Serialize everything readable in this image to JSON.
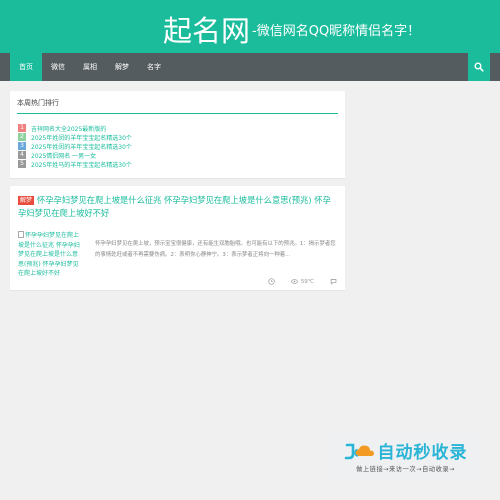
{
  "header": {
    "site_name": "起名网",
    "slogan": "-微信网名QQ昵称情侣名字！"
  },
  "nav": {
    "items": [
      {
        "label": "首页",
        "active": true
      },
      {
        "label": "微信",
        "active": false
      },
      {
        "label": "属相",
        "active": false
      },
      {
        "label": "解梦",
        "active": false
      },
      {
        "label": "名字",
        "active": false
      }
    ],
    "search_icon": "search-icon"
  },
  "ranking": {
    "title": "本周热门排行",
    "items": [
      {
        "num": "1",
        "text": "吉祥网名大全2025最新版的",
        "color": "#f08080"
      },
      {
        "num": "2",
        "text": "2025年姓闵的羊年宝宝起名精选30个",
        "color": "#8fd19e"
      },
      {
        "num": "3",
        "text": "2025年姓闵的羊年宝宝起名精选30个",
        "color": "#6aa8dc"
      },
      {
        "num": "4",
        "text": "2025情侣网名 一男一女",
        "color": "#999999"
      },
      {
        "num": "5",
        "text": "2025年姓马的羊年宝宝起名精选30个",
        "color": "#999999"
      }
    ]
  },
  "article": {
    "badge": "解梦",
    "title": "怀孕孕妇梦见在爬上坡是什么征兆 怀孕孕妇梦见在爬上坡是什么意思(预兆) 怀孕孕妇梦见在爬上坡好不好",
    "thumb_alt": "怀孕孕妇梦见在爬上坡是什么征兆 怀孕孕妇梦见在爬上坡是什么意思(预兆) 怀孕孕妇梦见在爬上坡好不好",
    "excerpt": "怀孕孕妇梦见在爬上坡，预示宝宝很健康，还有能生双胞胎哦。也可能有以下的预兆。1：揭示梦者您的事情乾旺或者不再需要伤病。2：表明你心静神宁。3：表示梦者正将向一种着...",
    "views": "59℃"
  },
  "watermark": {
    "text": "自动秒收录",
    "tagline": "做上链接→来访一次→自动收录→"
  },
  "colors": {
    "brand": "#1abc9c",
    "nav_bg": "#555c5f",
    "badge": "#e74c3c",
    "watermark_text": "#2ab4d6"
  }
}
